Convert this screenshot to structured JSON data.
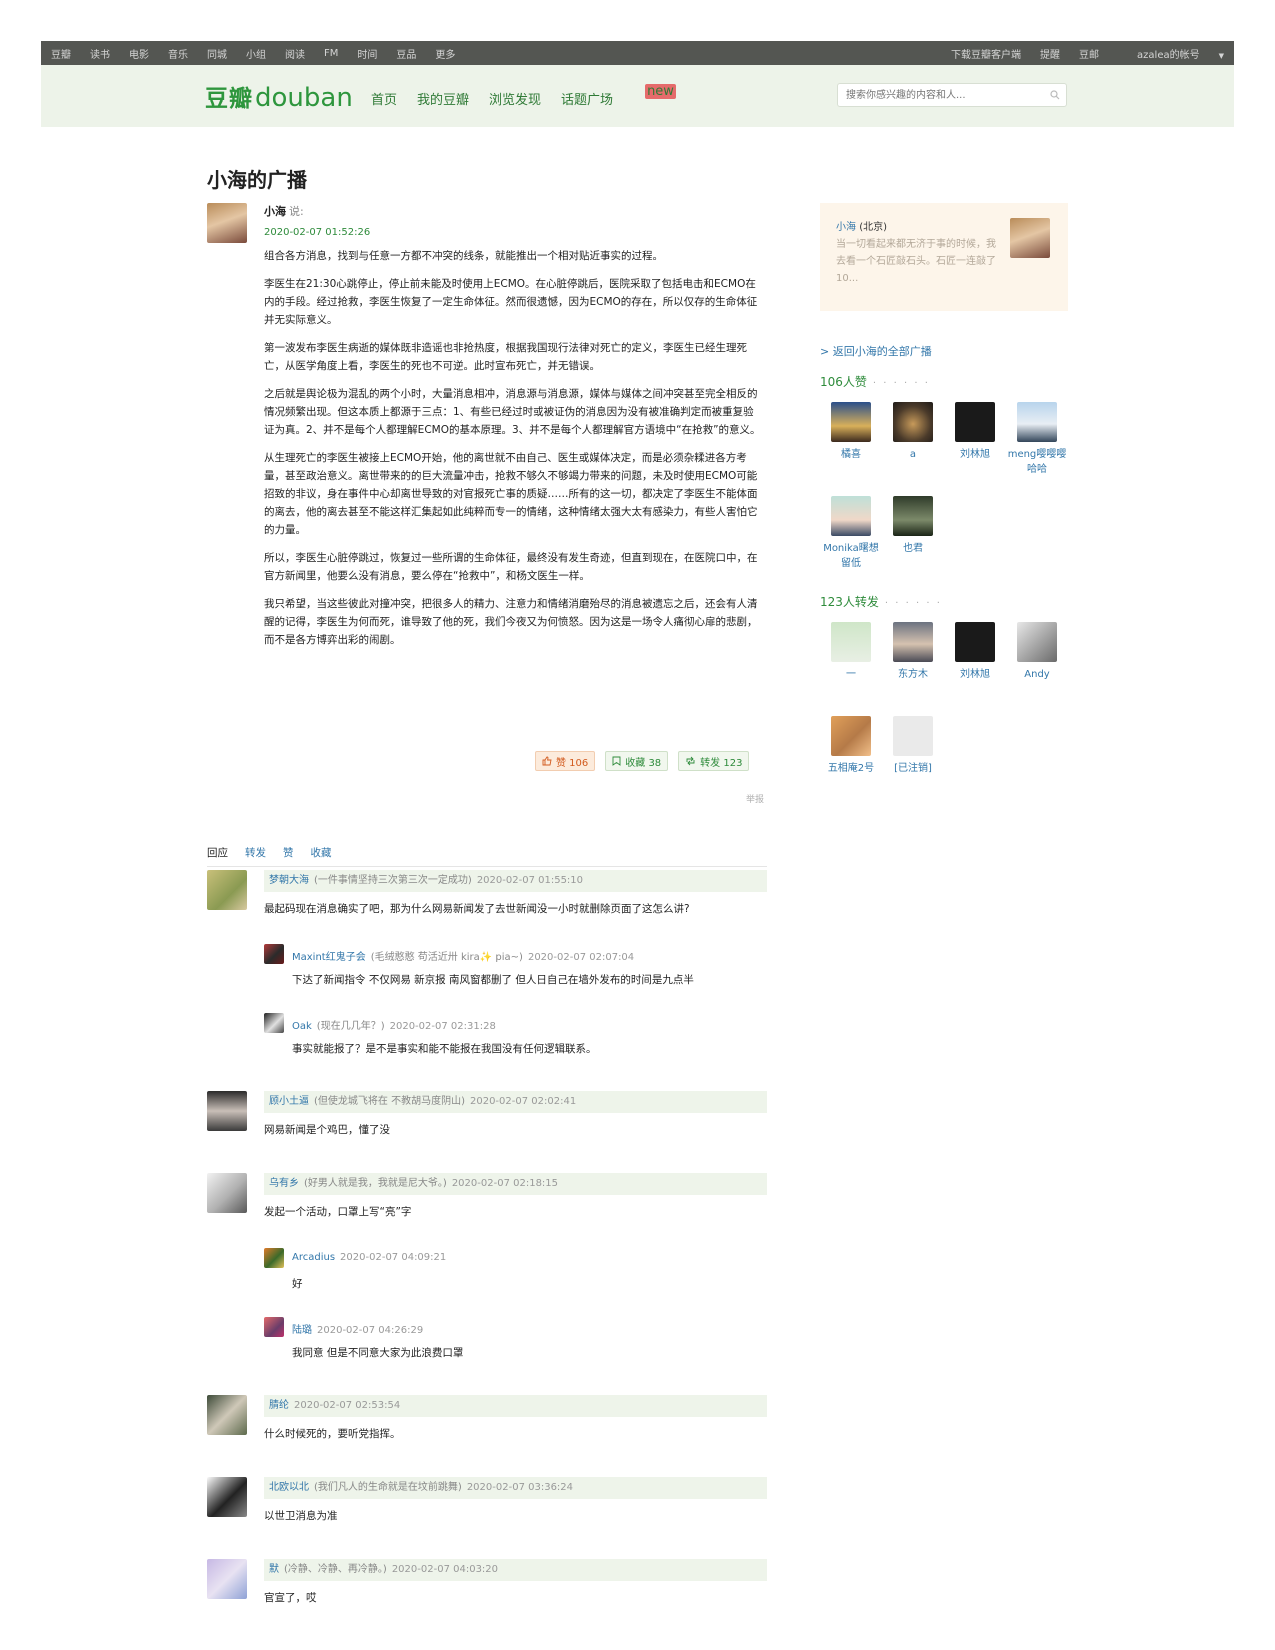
{
  "global_nav": {
    "left": [
      "豆瓣",
      "读书",
      "电影",
      "音乐",
      "同城",
      "小组",
      "阅读",
      "FM",
      "时间",
      "豆品",
      "更多"
    ],
    "right": [
      "下载豆瓣客户端",
      "提醒",
      "豆邮",
      "azalea的帐号"
    ]
  },
  "header": {
    "logo_cn": "豆瓣",
    "logo_en": "douban",
    "nav": [
      "首页",
      "我的豆瓣",
      "浏览发现",
      "话题广场"
    ],
    "new_badge": "new",
    "search_placeholder": "搜索你感兴趣的内容和人..."
  },
  "page": {
    "title": "小海的广播"
  },
  "status": {
    "author": "小海",
    "says": "说:",
    "time": "2020-02-07 01:52:26",
    "paragraphs": [
      "组合各方消息，找到与任意一方都不冲突的线条，就能推出一个相对贴近事实的过程。",
      "李医生在21:30心跳停止，停止前未能及时使用上ECMO。在心脏停跳后，医院采取了包括电击和ECMO在内的手段。经过抢救，李医生恢复了一定生命体征。然而很遗憾，因为ECMO的存在，所以仅存的生命体征并无实际意义。",
      "第一波发布李医生病逝的媒体既非造谣也非抢热度，根据我国现行法律对死亡的定义，李医生已经生理死亡，从医学角度上看，李医生的死也不可逆。此时宣布死亡，并无错误。",
      "之后就是舆论极为混乱的两个小时，大量消息相冲，消息源与消息源，媒体与媒体之间冲突甚至完全相反的情况频繁出现。但这本质上都源于三点：1、有些已经过时或被证伪的消息因为没有被准确判定而被重复验证为真。2、并不是每个人都理解ECMO的基本原理。3、并不是每个人都理解官方语境中“在抢救”的意义。",
      "从生理死亡的李医生被接上ECMO开始，他的离世就不由自己、医生或媒体决定，而是必须杂糅进各方考量，甚至政治意义。离世带来的的巨大流量冲击，抢救不够久不够竭力带来的问题，未及时使用ECMO可能招致的非议，身在事件中心却离世导致的对官报死亡事的质疑……所有的这一切，都决定了李医生不能体面的离去，他的离去甚至不能这样汇集起如此纯粹而专一的情绪，这种情绪太强大太有感染力，有些人害怕它的力量。",
      "所以，李医生心脏停跳过，恢复过一些所谓的生命体征，最终没有发生奇迹，但直到现在，在医院口中，在官方新闻里，他要么没有消息，要么停在“抢救中”，和杨文医生一样。",
      "我只希望，当这些彼此对撞冲突，把很多人的精力、注意力和情绪消磨殆尽的消息被遗忘之后，还会有人清醒的记得，李医生为何而死，谁导致了他的死，我们今夜又为何愤怒。因为这是一场令人痛彻心扉的悲剧，而不是各方博弈出彩的闹剧。"
    ],
    "like_label": "赞 106",
    "collect_label": "收藏 38",
    "reshare_label": "转发 123",
    "report_label": "举报"
  },
  "tabs": [
    "回应",
    "转发",
    "赞",
    "收藏"
  ],
  "comments": [
    {
      "name": "梦朝大海",
      "sig": "(一件事情坚持三次第三次一定成功)",
      "time": "2020-02-07 01:55:10",
      "text": "最起码现在消息确实了吧，那为什么网易新闻发了去世新闻没一小时就删除页面了这怎么讲?"
    },
    {
      "name": "顾小土逼",
      "sig": "(但使龙城飞将在 不教胡马度阴山)",
      "time": "2020-02-07 02:02:41",
      "text": "网易新闻是个鸡巴，懂了没"
    },
    {
      "name": "乌有乡",
      "sig": "(好男人就是我，我就是尼大爷。)",
      "time": "2020-02-07 02:18:15",
      "text": "发起一个活动，口罩上写“亮”字"
    },
    {
      "name": "腈纶",
      "sig": "",
      "time": "2020-02-07 02:53:54",
      "text": "什么时候死的，要听党指挥。"
    },
    {
      "name": "北欧以北",
      "sig": "(我们凡人的生命就是在坟前跳舞)",
      "time": "2020-02-07 03:36:24",
      "text": "以世卫消息为准"
    },
    {
      "name": "默",
      "sig": "(冷静、冷静、再冷静。)",
      "time": "2020-02-07 04:03:20",
      "text": "官宣了，哎"
    }
  ],
  "replies": [
    {
      "name": "Maxint红鬼子会",
      "sig": "(毛绒憨憨 苟活近卅 kira✨ pia~)",
      "time": "2020-02-07 02:07:04",
      "text": "下达了新闻指令 不仅网易 新京报 南风窗都删了 但人日自己在墙外发布的时间是九点半"
    },
    {
      "name": "Oak",
      "sig": "(现在几几年？)",
      "time": "2020-02-07 02:31:28",
      "text": "事实就能报了？是不是事实和能不能报在我国没有任何逻辑联系。"
    },
    {
      "name": "Arcadius",
      "sig": "",
      "time": "2020-02-07 04:09:21",
      "text": "好"
    },
    {
      "name": "陆璐",
      "sig": "",
      "time": "2020-02-07 04:26:29",
      "text": "我同意 但是不同意大家为此浪费口罩"
    }
  ],
  "sidebar": {
    "profile_name": "小海",
    "profile_loc": "(北京)",
    "profile_intro": "当一切看起来都无济于事的时候，我去看一个石匠敲石头。石匠一连敲了10...",
    "back_link": "> 返回小海的全部广播",
    "likes_title": "106人赞",
    "reshares_title": "123人转发",
    "dots": "· · · · · ·",
    "likers": [
      "橘喜",
      "a",
      "刘林旭",
      "meng嘤嘤嘤哈哈",
      "Monika曙想留低",
      "也君"
    ],
    "resharers": [
      "一",
      "东方木",
      "刘林旭",
      "Andy",
      "五相庵2号",
      "[已注销]"
    ]
  },
  "colors": {
    "brand_green": "#2e963d",
    "link_blue": "#3377aa",
    "topbar": "#545652",
    "header_bg": "#edf3e9"
  }
}
